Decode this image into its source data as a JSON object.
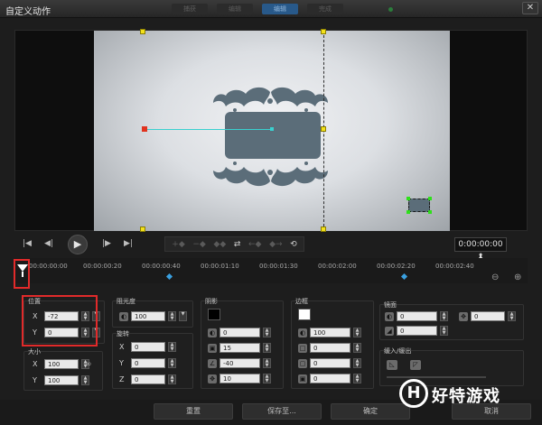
{
  "window": {
    "title": "自定义动作",
    "close_glyph": "✕"
  },
  "background_tabs": [
    "捕获",
    "编辑",
    "编辑",
    "完成"
  ],
  "transport": {
    "buttons": {
      "home": "|◀",
      "prev_frame": "◀|",
      "play": "▶",
      "next_frame": "|▶",
      "end": "▶|"
    },
    "timecode": "0:00:00:00 ⬍",
    "keyframe_tools": [
      "+◆",
      "−◆",
      "◆◆",
      "⇄",
      "←◆",
      "◆→",
      "⟲"
    ]
  },
  "timeline": {
    "ticks": [
      "00:00:00:00",
      "00:00:00:20",
      "00:00:00:40",
      "00:00:01:10",
      "00:00:01:30",
      "00:00:02:00",
      "00:00:02:20",
      "00:00:02:40"
    ],
    "zoom_out": "⊖",
    "zoom_in": "⊕"
  },
  "position": {
    "label": "位置",
    "x": "-72",
    "y": "0"
  },
  "size": {
    "label": "大小",
    "x": "100",
    "y": "100"
  },
  "opacity": {
    "label": "阻光度",
    "value": "100"
  },
  "rotation": {
    "label": "旋转",
    "x": "0",
    "y": "0",
    "z": "0"
  },
  "shadow": {
    "label": "阴影",
    "color": "#000000",
    "v1": "0",
    "v2": "15",
    "v3": "-40",
    "v4": "10"
  },
  "border": {
    "label": "边框",
    "color": "#ffffff",
    "v1": "100",
    "v2": "0",
    "v3": "0",
    "v4": "0"
  },
  "mirror": {
    "label": "镜面",
    "v1": "0",
    "v2": "0",
    "v3": "0"
  },
  "fade": {
    "label": "缓入/缓出"
  },
  "axes": {
    "x": "X",
    "y": "Y",
    "z": "Z"
  },
  "buttons": {
    "reset": "重置",
    "save_to": "保存至...",
    "ok": "确定",
    "cancel": "取消"
  },
  "watermark": {
    "logo": "H",
    "text": "好特游戏"
  },
  "colors": {
    "accent": "#3ad0cf",
    "handle": "#f3e11b",
    "highlight": "#e12a2a",
    "object": "#5b6d79"
  }
}
